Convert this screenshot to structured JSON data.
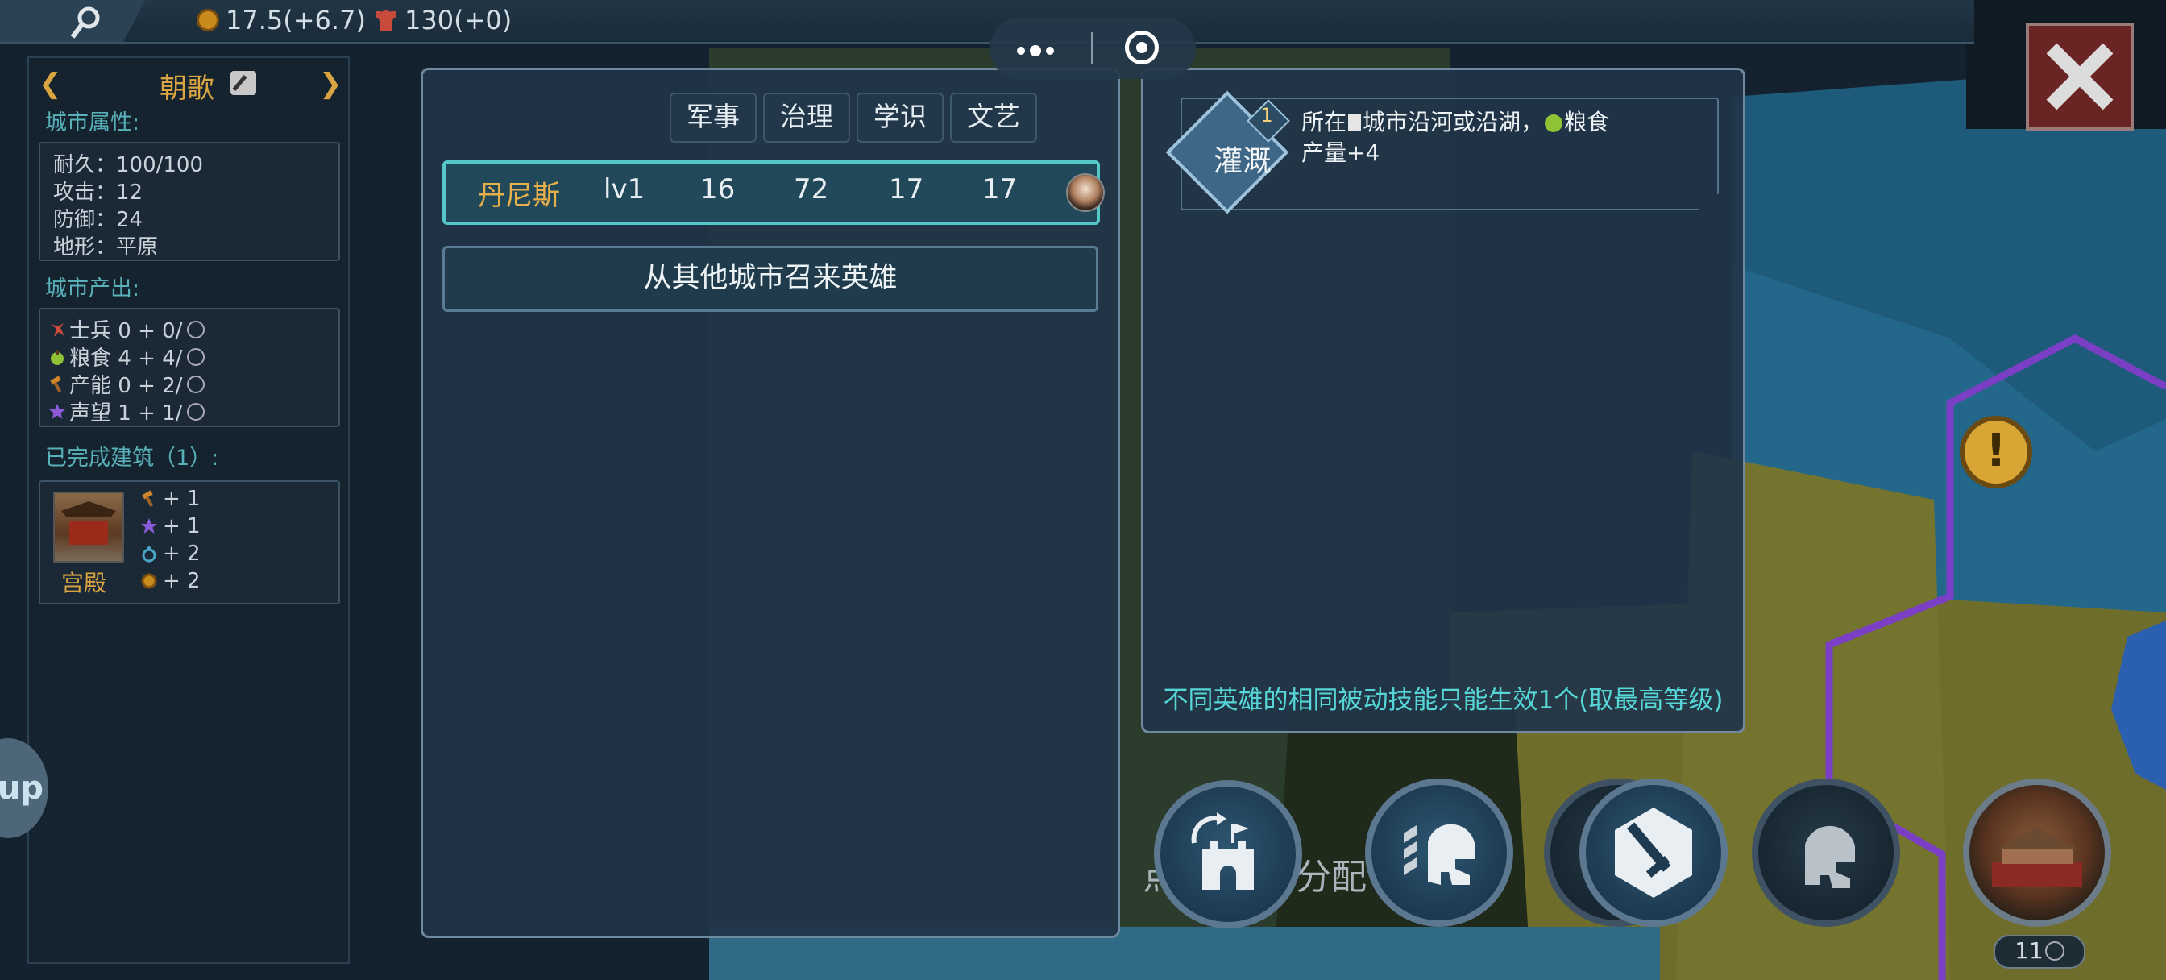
{
  "topbar": {
    "gold": "17.5(+6.7)",
    "soldiers": "130(+0)"
  },
  "city": {
    "name": "朝歌",
    "prev_arrow": "❮",
    "next_arrow": "❯",
    "attributes_title": "城市属性:",
    "attributes": [
      "耐久：100/100",
      "攻击：12",
      "防御：24",
      "地形：平原"
    ],
    "output_title": "城市产出:",
    "outputs": [
      {
        "label": "士兵 0 + 0/",
        "icon": "soldier-icon",
        "color": "#d04a3a"
      },
      {
        "label": "粮食 4 + 4/",
        "icon": "apple-icon",
        "color": "#8fc234"
      },
      {
        "label": "产能 0 + 2/",
        "icon": "hammer-icon",
        "color": "#d0862a"
      },
      {
        "label": "声望 1 + 1/",
        "icon": "star-icon",
        "color": "#8a5ad8"
      }
    ],
    "buildings_title": "已完成建筑（1）:",
    "building": {
      "name": "宫殿",
      "bonuses": [
        {
          "text": "+ 1",
          "icon": "hammer-icon"
        },
        {
          "text": "+ 1",
          "icon": "star-icon"
        },
        {
          "text": "+ 2",
          "icon": "culture-icon"
        },
        {
          "text": "+ 2",
          "icon": "coin-icon"
        }
      ]
    }
  },
  "hero_panel": {
    "tabs": [
      "军事",
      "治理",
      "学识",
      "文艺"
    ],
    "hero": {
      "name": "丹尼斯",
      "level": "lv1",
      "military": "16",
      "governance": "72",
      "knowledge": "17",
      "arts": "17"
    },
    "summon_label": "从其他城市召来英雄"
  },
  "skill_panel": {
    "skill_name": "灌溉",
    "skill_level": "1",
    "desc_part1": "所在",
    "desc_part2": "城市沿河或沿湖，",
    "desc_part3": "粮食",
    "desc_line2": "产量+4",
    "note": "不同英雄的相同被动技能只能生效1个(取最高等级)"
  },
  "bottom": {
    "partial_text_a": "点",
    "partial_text_b": "分配",
    "turn_badge": "11",
    "left_edge_text": "up"
  },
  "alert": "!",
  "colors": {
    "accent_gold": "#d9a441",
    "accent_teal": "#56d6d6",
    "panel_border": "#6f8aa0",
    "close_red": "#6b2424",
    "territory_purple": "#7a3fc4"
  }
}
